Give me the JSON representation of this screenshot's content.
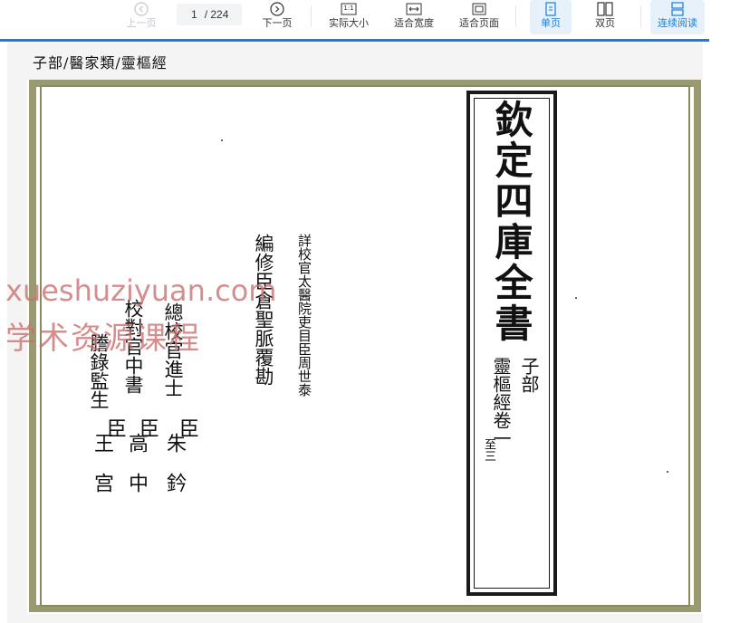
{
  "toolbar": {
    "prev_label": "上一页",
    "page_current": "1",
    "page_total": "/ 224",
    "next_label": "下一页",
    "actual_size_label": "实际大小",
    "fit_width_label": "适合宽度",
    "fit_page_label": "适合页面",
    "single_page_label": "单页",
    "double_page_label": "双页",
    "continuous_label": "连续阅读",
    "actual_size_badge": "1:1"
  },
  "document": {
    "breadcrumb": "子部/醫家類/靈樞經",
    "title_main": "欽定四庫全書",
    "title_section": "子部",
    "title_book": "靈樞經卷一",
    "title_range": "至三",
    "reviewer_line": "詳校官太醫院吏目臣周世泰",
    "editor_line": "編修臣倉聖脈覆勘",
    "chief_line": "總校官進士",
    "proof_line": "校對官中書",
    "copy_line": "謄錄監生",
    "chen1": "臣",
    "chen2": "臣",
    "chen3": "臣",
    "name1": "朱　鈐",
    "name2": "高　中",
    "name3": "王　宫"
  },
  "watermark": {
    "line1": "xueshuziyuan.com",
    "line2": "学术资源课程"
  },
  "colors": {
    "accent": "#1a7fd4",
    "frame_border": "#9a9a70",
    "watermark": "#c86e6e"
  }
}
